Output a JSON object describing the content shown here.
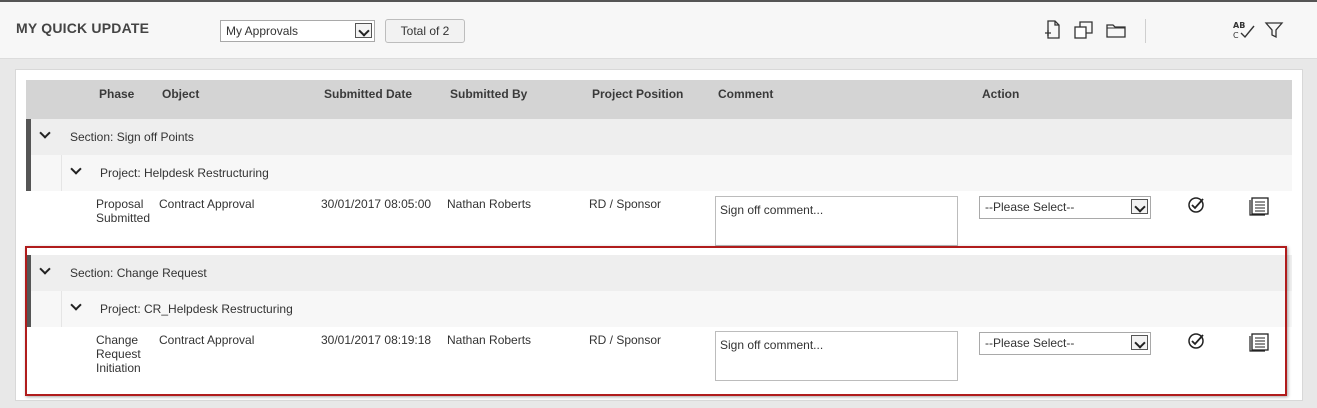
{
  "header": {
    "title": "MY QUICK UPDATE",
    "view_select": "My Approvals",
    "total_label": "Total of 2"
  },
  "toolbar": {
    "icons": [
      "new-document-icon",
      "copy-icon",
      "folder-icon",
      "spell-check-icon",
      "filter-icon"
    ],
    "spell_icon_text": "AB C"
  },
  "grid": {
    "columns": [
      "Phase",
      "Object",
      "Submitted Date",
      "Submitted By",
      "Project Position",
      "Comment",
      "Action"
    ]
  },
  "sections": [
    {
      "label": "Section: Sign off Points",
      "project": "Project: Helpdesk Restructuring",
      "row": {
        "phase_lines": [
          "Proposal",
          "Submitted"
        ],
        "object": "Contract Approval",
        "submitted_date": "30/01/2017 08:05:00",
        "submitted_by": "Nathan Roberts",
        "project_position": "RD / Sponsor",
        "comment_placeholder": "Sign off comment...",
        "action_select": "--Please Select--"
      }
    },
    {
      "label": "Section: Change Request",
      "project": "Project: CR_Helpdesk Restructuring",
      "row": {
        "phase_lines": [
          "Change",
          "Request",
          "Initiation"
        ],
        "object": "Contract Approval",
        "submitted_date": "30/01/2017 08:19:18",
        "submitted_by": "Nathan Roberts",
        "project_position": "RD / Sponsor",
        "comment_placeholder": "Sign off comment...",
        "action_select": "--Please Select--"
      }
    }
  ],
  "colors": {
    "highlight": "#b01c1c",
    "header_bg": "#d4d4d4",
    "section_bar": "#555555"
  }
}
